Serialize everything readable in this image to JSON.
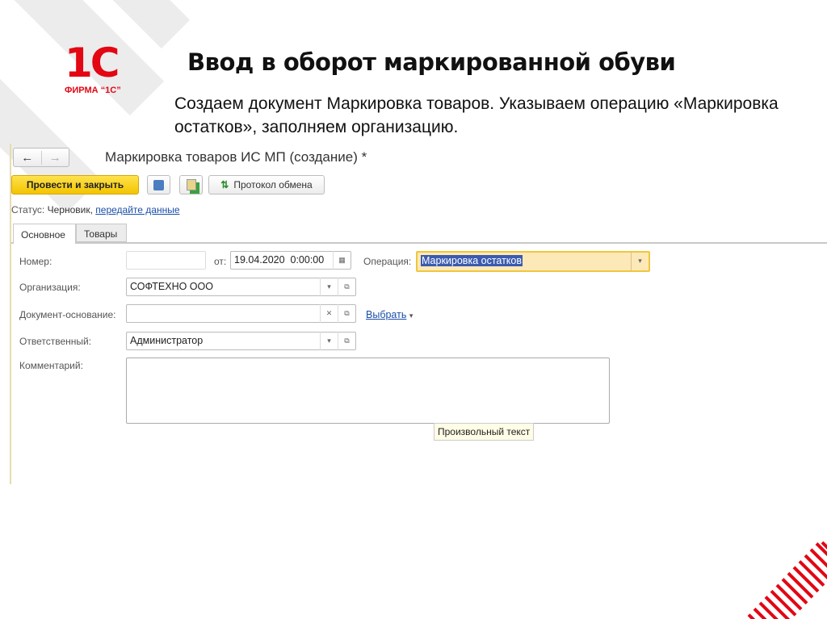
{
  "slide": {
    "title": "Ввод в оборот маркированной обуви",
    "subtitle": "Создаем документ Маркировка товаров. Указываем операцию «Маркировка остатков», заполняем организацию.",
    "logo_text": "ФИРМА “1С”",
    "logo_mark": "1С",
    "accent": "#e30613"
  },
  "window": {
    "title": "Маркировка товаров ИС МП (создание) *",
    "back": "←",
    "forward": "→"
  },
  "toolbar": {
    "post_close": "Провести и закрыть",
    "exchange_log": "Протокол обмена"
  },
  "status": {
    "label": "Статус:",
    "value": "Черновик,",
    "link": "передайте данные"
  },
  "tabs": [
    {
      "label": "Основное"
    },
    {
      "label": "Товары"
    }
  ],
  "form": {
    "number_label": "Номер:",
    "number_value": "",
    "date_label": "от:",
    "date_value": "19.04.2020  0:00:00",
    "operation_label": "Операция:",
    "operation_value": "Маркировка остатков",
    "org_label": "Организация:",
    "org_value": "СОФТЕХНО ООО",
    "basis_label": "Документ-основание:",
    "basis_value": "",
    "select_link": "Выбрать",
    "resp_label": "Ответственный:",
    "resp_value": "Администратор",
    "comment_label": "Комментарий:",
    "comment_value": "",
    "tooltip": "Произвольный текст"
  }
}
